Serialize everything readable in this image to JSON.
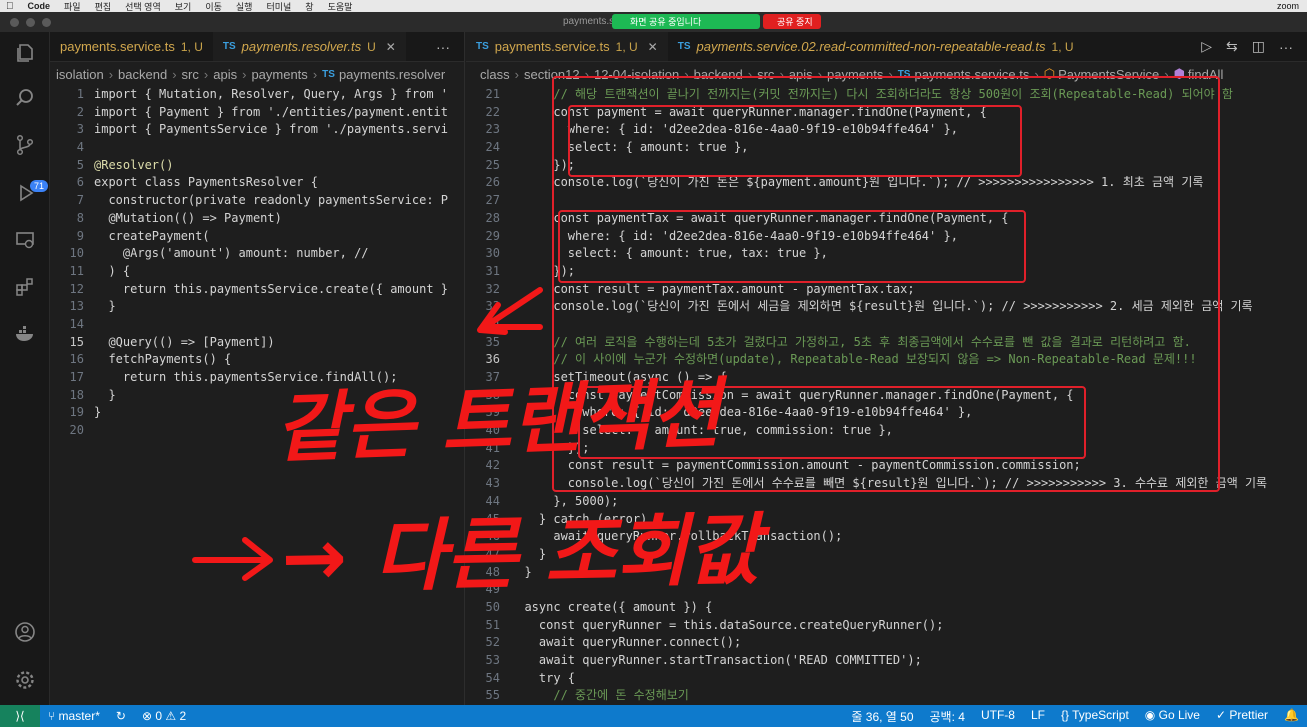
{
  "menubar": {
    "app": "Code",
    "items": [
      "파일",
      "편집",
      "선택 영역",
      "보기",
      "이동",
      "실행",
      "터미널",
      "창",
      "도움말"
    ],
    "right": [
      "zoom"
    ]
  },
  "window": {
    "title": "payments.s",
    "share_status": "화면 공유 중입니다",
    "stop_share": "공유 중지"
  },
  "activity": {
    "scm_badge": "71",
    "icons": [
      "files-icon",
      "search-icon",
      "source-control-icon",
      "run-debug-icon",
      "remote-explorer-icon",
      "extensions-icon",
      "docker-icon",
      "account-icon",
      "settings-icon"
    ]
  },
  "left_group": {
    "tabs": [
      {
        "label": "payments.service.ts",
        "status": "1, U",
        "active": false,
        "italic": false
      },
      {
        "label": "payments.resolver.ts",
        "status": "U",
        "active": true,
        "italic": true
      }
    ],
    "breadcrumb": [
      "isolation",
      "backend",
      "src",
      "apis",
      "payments",
      "payments.resolver"
    ],
    "lines": [
      {
        "n": "1",
        "t": "import { Mutation, Resolver, Query, Args } from '",
        "c": "txt"
      },
      {
        "n": "2",
        "t": "import { Payment } from './entities/payment.entit",
        "c": "txt"
      },
      {
        "n": "3",
        "t": "import { PaymentsService } from './payments.servi",
        "c": "txt"
      },
      {
        "n": "4",
        "t": "",
        "c": "txt"
      },
      {
        "n": "5",
        "t": "@Resolver()",
        "c": "txt fn"
      },
      {
        "n": "6",
        "t": "export class PaymentsResolver {",
        "c": "txt"
      },
      {
        "n": "7",
        "t": "  constructor(private readonly paymentsService: P",
        "c": "txt"
      },
      {
        "n": "8",
        "t": "  @Mutation(() => Payment)",
        "c": "txt"
      },
      {
        "n": "9",
        "t": "  createPayment(",
        "c": "txt"
      },
      {
        "n": "10",
        "t": "    @Args('amount') amount: number, //",
        "c": "txt"
      },
      {
        "n": "11",
        "t": "  ) {",
        "c": "txt"
      },
      {
        "n": "12",
        "t": "    return this.paymentsService.create({ amount }",
        "c": "txt"
      },
      {
        "n": "13",
        "t": "  }",
        "c": "txt"
      },
      {
        "n": "14",
        "t": "",
        "c": "txt"
      },
      {
        "n": "15",
        "t": "  @Query(() => [Payment])",
        "c": "txt"
      },
      {
        "n": "16",
        "t": "  fetchPayments() {",
        "c": "txt"
      },
      {
        "n": "17",
        "t": "    return this.paymentsService.findAll();",
        "c": "txt"
      },
      {
        "n": "18",
        "t": "  }",
        "c": "txt"
      },
      {
        "n": "19",
        "t": "}",
        "c": "txt"
      },
      {
        "n": "20",
        "t": "",
        "c": "txt"
      }
    ]
  },
  "right_group": {
    "tabs": [
      {
        "label": "payments.service.ts",
        "status": "1, U",
        "active": true,
        "italic": false
      },
      {
        "label": "payments.service.02.read-committed-non-repeatable-read.ts",
        "status": "1, U",
        "active": false,
        "italic": true
      }
    ],
    "breadcrumb": [
      "class",
      "section12",
      "12-04-isolation",
      "backend",
      "src",
      "apis",
      "payments",
      "payments.service.ts",
      "PaymentsService",
      "findAll"
    ],
    "lines": [
      {
        "n": "21",
        "t": "      // 해당 트랜잭션이 끝나기 전까지는(커밋 전까지는) 다시 조회하더라도 항상 500원이 조회(Repeatable-Read) 되어야 함",
        "c": "txt cmt"
      },
      {
        "n": "22",
        "t": "      const payment = await queryRunner.manager.findOne(Payment, {",
        "c": "txt"
      },
      {
        "n": "23",
        "t": "        where: { id: 'd2ee2dea-816e-4aa0-9f19-e10b94ffe464' },",
        "c": "txt"
      },
      {
        "n": "24",
        "t": "        select: { amount: true },",
        "c": "txt"
      },
      {
        "n": "25",
        "t": "      });",
        "c": "txt"
      },
      {
        "n": "26",
        "t": "      console.log(`당신이 가진 돈은 ${payment.amount}원 입니다.`); // >>>>>>>>>>>>>>>> 1. 최초 금액 기록",
        "c": "txt"
      },
      {
        "n": "27",
        "t": "",
        "c": "txt"
      },
      {
        "n": "28",
        "t": "      const paymentTax = await queryRunner.manager.findOne(Payment, {",
        "c": "txt"
      },
      {
        "n": "29",
        "t": "        where: { id: 'd2ee2dea-816e-4aa0-9f19-e10b94ffe464' },",
        "c": "txt"
      },
      {
        "n": "30",
        "t": "        select: { amount: true, tax: true },",
        "c": "txt"
      },
      {
        "n": "31",
        "t": "      });",
        "c": "txt"
      },
      {
        "n": "32",
        "t": "      const result = paymentTax.amount - paymentTax.tax;",
        "c": "txt"
      },
      {
        "n": "33",
        "t": "      console.log(`당신이 가진 돈에서 세금을 제외하면 ${result}원 입니다.`); // >>>>>>>>>>> 2. 세금 제외한 금액 기록",
        "c": "txt"
      },
      {
        "n": "34",
        "t": "",
        "c": "txt"
      },
      {
        "n": "35",
        "t": "      // 여러 로직을 수행하는데 5초가 걸렸다고 가정하고, 5초 후 최종금액에서 수수료를 뺀 값을 결과로 리턴하려고 함.",
        "c": "txt cmt"
      },
      {
        "n": "36",
        "t": "      // 이 사이에 누군가 수정하면(update), Repeatable-Read 보장되지 않음 => Non-Repeatable-Read 문제!!!",
        "c": "txt cmt"
      },
      {
        "n": "37",
        "t": "      setTimeout(async () => {",
        "c": "txt"
      },
      {
        "n": "38",
        "t": "        const paymentCommission = await queryRunner.manager.findOne(Payment, {",
        "c": "txt"
      },
      {
        "n": "39",
        "t": "          where: { id: 'd2ee2dea-816e-4aa0-9f19-e10b94ffe464' },",
        "c": "txt"
      },
      {
        "n": "40",
        "t": "          select: { amount: true, commission: true },",
        "c": "txt"
      },
      {
        "n": "41",
        "t": "        });",
        "c": "txt"
      },
      {
        "n": "42",
        "t": "        const result = paymentCommission.amount - paymentCommission.commission;",
        "c": "txt"
      },
      {
        "n": "43",
        "t": "        console.log(`당신이 가진 돈에서 수수료를 빼면 ${result}원 입니다.`); // >>>>>>>>>>> 3. 수수료 제외한 금액 기록",
        "c": "txt"
      },
      {
        "n": "44",
        "t": "      }, 5000);",
        "c": "txt"
      },
      {
        "n": "45",
        "t": "    } catch (error) {",
        "c": "txt"
      },
      {
        "n": "46",
        "t": "      await queryRunner.rollbackTransaction();",
        "c": "txt"
      },
      {
        "n": "47",
        "t": "    }",
        "c": "txt"
      },
      {
        "n": "48",
        "t": "  }",
        "c": "txt"
      },
      {
        "n": "49",
        "t": "",
        "c": "txt"
      },
      {
        "n": "50",
        "t": "  async create({ amount }) {",
        "c": "txt"
      },
      {
        "n": "51",
        "t": "    const queryRunner = this.dataSource.createQueryRunner();",
        "c": "txt"
      },
      {
        "n": "52",
        "t": "    await queryRunner.connect();",
        "c": "txt"
      },
      {
        "n": "53",
        "t": "    await queryRunner.startTransaction('READ COMMITTED');",
        "c": "txt"
      },
      {
        "n": "54",
        "t": "    try {",
        "c": "txt"
      },
      {
        "n": "55",
        "t": "      // 중간에 돈 수정해보기",
        "c": "txt cmt"
      }
    ]
  },
  "statusbar": {
    "branch": "master*",
    "problems": "⊗ 0 ⚠ 2",
    "position": "줄 36, 열 50",
    "spaces": "공백: 4",
    "encoding": "UTF-8",
    "eol": "LF",
    "language": "{} TypeScript",
    "golive": "Go Live",
    "prettier": "✓ Prettier"
  },
  "handwriting": {
    "line1": "같은 트랜잭션",
    "line2": "→ 다른 조회값"
  }
}
